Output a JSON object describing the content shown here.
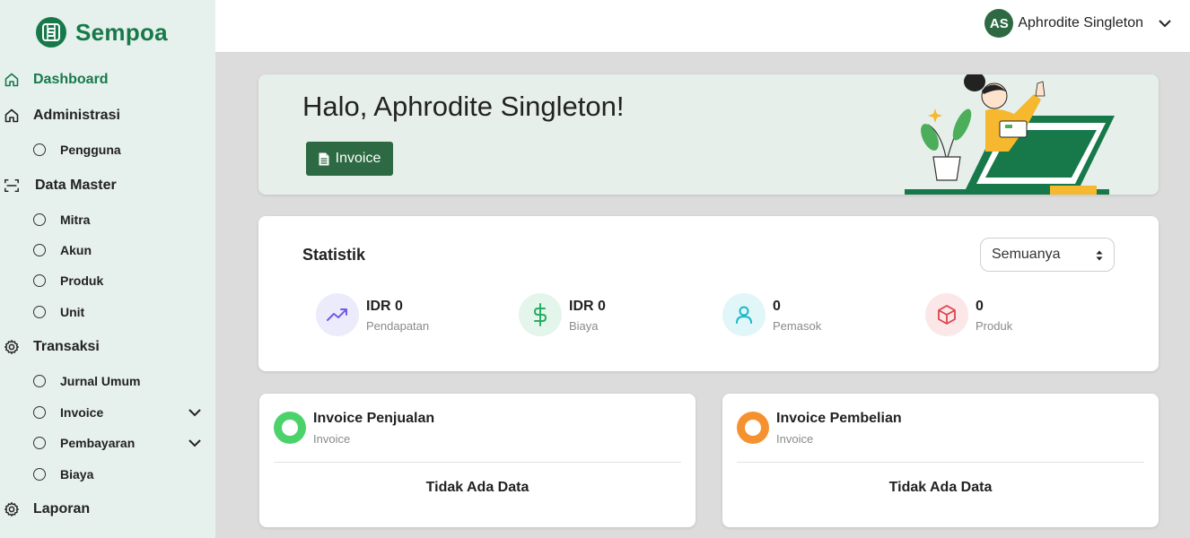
{
  "brand": {
    "name": "Sempoa",
    "color": "#17794a"
  },
  "sidebar": {
    "items": [
      {
        "label": "Dashboard",
        "icon": "home-icon",
        "active": true
      },
      {
        "label": "Administrasi",
        "icon": "home-icon"
      },
      {
        "label": "Pengguna",
        "sub": true
      },
      {
        "label": "Data Master",
        "icon": "scan-icon"
      },
      {
        "label": "Mitra",
        "sub": true
      },
      {
        "label": "Akun",
        "sub": true
      },
      {
        "label": "Produk",
        "sub": true
      },
      {
        "label": "Unit",
        "sub": true
      },
      {
        "label": "Transaksi",
        "icon": "gear-icon"
      },
      {
        "label": "Jurnal Umum",
        "sub": true
      },
      {
        "label": "Invoice",
        "sub": true,
        "expandable": true
      },
      {
        "label": "Pembayaran",
        "sub": true,
        "expandable": true
      },
      {
        "label": "Biaya",
        "sub": true
      },
      {
        "label": "Laporan",
        "icon": "gear-icon"
      }
    ]
  },
  "topbar": {
    "user_initials": "AS",
    "user_name": "Aphrodite Singleton"
  },
  "welcome": {
    "greeting": "Halo, Aphrodite Singleton!",
    "button_label": "Invoice"
  },
  "stats": {
    "title": "Statistik",
    "filter_value": "Semuanya",
    "items": [
      {
        "value": "IDR 0",
        "label": "Pendapatan",
        "icon": "trending-up-icon",
        "color": "#6c5ce7",
        "bg": "#ecebfb"
      },
      {
        "value": "IDR 0",
        "label": "Biaya",
        "icon": "dollar-icon",
        "color": "#27ae60",
        "bg": "#e4f5eb"
      },
      {
        "value": "0",
        "label": "Pemasok",
        "icon": "user-icon",
        "color": "#1ab7c9",
        "bg": "#e1f6f8"
      },
      {
        "value": "0",
        "label": "Produk",
        "icon": "box-icon",
        "color": "#e0434d",
        "bg": "#fbe7e8"
      }
    ]
  },
  "invoices": [
    {
      "title": "Invoice Penjualan",
      "subtitle": "Invoice",
      "empty": "Tidak Ada Data",
      "color": "#4cd26b"
    },
    {
      "title": "Invoice Pembelian",
      "subtitle": "Invoice",
      "empty": "Tidak Ada Data",
      "color": "#f5922f"
    }
  ]
}
